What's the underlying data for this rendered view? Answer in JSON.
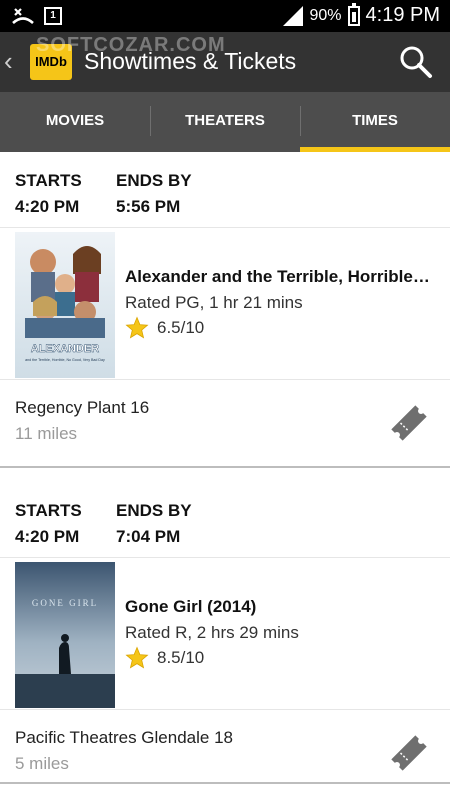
{
  "status_bar": {
    "notification_count": "1",
    "battery": "90%",
    "time": "4:19 PM"
  },
  "app_bar": {
    "logo_text": "IMDb",
    "title": "Showtimes & Tickets",
    "watermark": "SOFTCOZAR.COM"
  },
  "tabs": [
    {
      "label": "MOVIES",
      "active": false
    },
    {
      "label": "THEATERS",
      "active": false
    },
    {
      "label": "TIMES",
      "active": true
    }
  ],
  "showtimes": [
    {
      "starts_label": "STARTS",
      "starts_time": "4:20 PM",
      "ends_label": "ENDS BY",
      "ends_time": "5:56 PM",
      "movie": {
        "title": "Alexander and the Terrible, Horrible, No Good, Very Bad Day",
        "rating": "Rated PG, 1 hr 21 mins",
        "score": "6.5/10",
        "poster_title": "ALEXANDER",
        "poster_subtitle": "and the Terrible, Horrible, No Good, Very Bad Day"
      },
      "theater": {
        "name": "Regency Plant 16",
        "distance": "11 miles"
      }
    },
    {
      "starts_label": "STARTS",
      "starts_time": "4:20 PM",
      "ends_label": "ENDS BY",
      "ends_time": "7:04 PM",
      "movie": {
        "title": "Gone Girl (2014)",
        "rating": "Rated R, 2 hrs 29 mins",
        "score": "8.5/10",
        "poster_title": "GONE GIRL",
        "poster_subtitle": ""
      },
      "theater": {
        "name": "Pacific Theatres Glendale 18",
        "distance": "5 miles"
      }
    }
  ],
  "colors": {
    "accent": "#f5c518",
    "app_bar": "#333333",
    "tab_bar": "#4d4d4d"
  }
}
